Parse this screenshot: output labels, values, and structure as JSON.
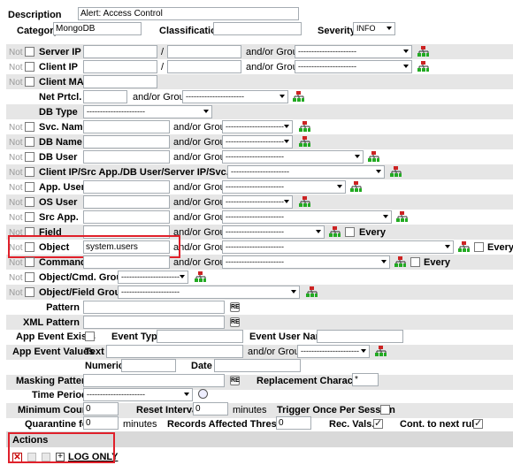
{
  "form": {
    "description_label": "Description",
    "description_value": "Alert: Access Control",
    "category_label": "Category",
    "category_value": "MongoDB",
    "classification_label": "Classification",
    "classification_value": "",
    "severity_label": "Severity",
    "severity_value": "INFO"
  },
  "common": {
    "not": "Not",
    "and_or_group": "and/or Group",
    "dashes": "----------------------",
    "slash": "/",
    "every": "Every"
  },
  "fields": {
    "server_ip": "Server IP",
    "client_ip": "Client IP",
    "client_mac": "Client MAC",
    "net_prtcl": "Net Prtcl.",
    "db_type": "DB Type",
    "svc_name": "Svc. Name",
    "db_name": "DB Name",
    "db_user": "DB User",
    "client_ip_src": "Client IP/Src App./DB User/Server IP/Svc. Name",
    "app_user": "App. User",
    "os_user": "OS User",
    "src_app": "Src App.",
    "field": "Field",
    "object": "Object",
    "object_value": "system.users",
    "command": "Command",
    "object_cmd_group": "Object/Cmd. Group",
    "object_field_group": "Object/Field Group",
    "pattern": "Pattern",
    "xml_pattern": "XML Pattern"
  },
  "event": {
    "app_event_exists": "App Event Exists",
    "event_type": "Event Type",
    "event_user_name": "Event User Name",
    "app_event_values": "App Event Values",
    "text": "Text",
    "numeric": "Numeric",
    "date": "Date",
    "masking_pattern": "Masking Pattern",
    "replacement_character": "Replacement Character",
    "replacement_value": "*",
    "time_period": "Time Period"
  },
  "thresholds": {
    "minimum_count": "Minimum Count",
    "minimum_count_value": "0",
    "reset_interval": "Reset Interval",
    "reset_interval_value": "0",
    "minutes": "minutes",
    "trigger_once": "Trigger Once Per Session",
    "quarantine_for": "Quarantine for",
    "quarantine_value": "0",
    "records_affected": "Records Affected Threshold",
    "records_value": "0",
    "rec_vals": "Rec. Vals.",
    "cont_next_rule": "Cont. to next rule"
  },
  "actions": {
    "header": "Actions",
    "log_only": "LOG ONLY"
  },
  "colors": {
    "highlight_border": "#e0202a",
    "row_background": "#e6e6e6",
    "actions_background": "#d9d9d9"
  }
}
